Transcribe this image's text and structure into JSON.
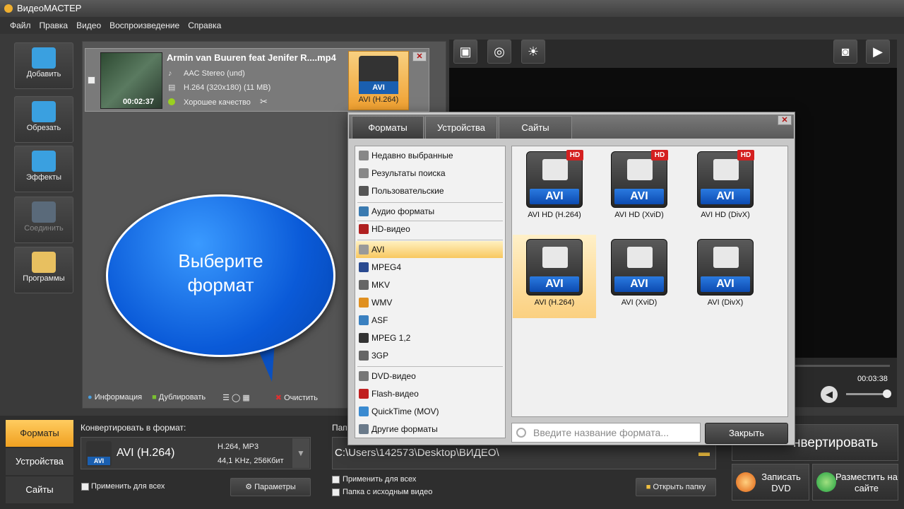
{
  "app": {
    "title": "ВидеоМАСТЕР"
  },
  "menu": [
    "Файл",
    "Правка",
    "Видео",
    "Воспроизведение",
    "Справка"
  ],
  "sidebar": [
    {
      "label": "Добавить",
      "icon": "film-add-icon",
      "color": "#3aa0e0"
    },
    {
      "label": "Обрезать",
      "icon": "scissors-icon",
      "color": "#3aa0e0"
    },
    {
      "label": "Эффекты",
      "icon": "magic-wand-icon",
      "color": "#3aa0e0"
    },
    {
      "label": "Соединить",
      "icon": "join-icon",
      "color": "#5a6a7a"
    },
    {
      "label": "Программы",
      "icon": "programs-icon",
      "color": "#e8c060"
    }
  ],
  "file": {
    "name": "Armin van Buuren feat Jenifer R....mp4",
    "duration": "00:02:37",
    "audio": "AAC Stereo (und)",
    "video": "H.264 (320x180) (11 MB)",
    "quality": "Хорошее качество",
    "format_label": "AVI (H.264)",
    "cam_label": "AVI"
  },
  "bubble": {
    "line1": "Выберите",
    "line2": "формат"
  },
  "filebar": {
    "info": "Информация",
    "duplicate": "Дублировать",
    "clear": "Очистить"
  },
  "player": {
    "time": "00:03:38"
  },
  "bottom": {
    "tabs": [
      "Форматы",
      "Устройства",
      "Сайты"
    ],
    "convert_label": "Конвертировать в формат:",
    "format_name": "AVI (H.264)",
    "format_badge": "AVI",
    "spec1": "H.264, MP3",
    "spec2": "44,1 KHz, 256Кбит",
    "apply_all": "Применить для всех",
    "params": "Параметры",
    "folder_label": "Папка",
    "path": "C:\\Users\\142573\\Desktop\\ВИДЕО\\",
    "apply_all2": "Применить для всех",
    "src_folder": "Папка с исходным видео",
    "open_folder": "Открыть папку",
    "convert": "Конвертировать",
    "convert_visible": "нвертировать",
    "dvd": "Записать DVD",
    "web": "Разместить на сайте"
  },
  "dialog": {
    "tabs": [
      "Форматы",
      "Устройства",
      "Сайты"
    ],
    "list": [
      {
        "label": "Недавно выбранные",
        "icon": "recent-icon",
        "color": "#888"
      },
      {
        "label": "Результаты поиска",
        "icon": "search-results-icon",
        "color": "#888"
      },
      {
        "label": "Пользовательские",
        "icon": "user-icon",
        "color": "#555"
      },
      {
        "label": "Аудио форматы",
        "icon": "music-note-icon",
        "color": "#3a7ab0"
      },
      {
        "label": "HD-видео",
        "icon": "hd-icon",
        "color": "#b02020"
      },
      {
        "label": "AVI",
        "icon": "disc-icon",
        "color": "#999"
      },
      {
        "label": "MPEG4",
        "icon": "mpeg4-icon",
        "color": "#2a4a90"
      },
      {
        "label": "MKV",
        "icon": "mkv-icon",
        "color": "#666"
      },
      {
        "label": "WMV",
        "icon": "wmv-icon",
        "color": "#e09020"
      },
      {
        "label": "ASF",
        "icon": "asf-icon",
        "color": "#3a80c0"
      },
      {
        "label": "MPEG 1,2",
        "icon": "mpeg-icon",
        "color": "#333"
      },
      {
        "label": "3GP",
        "icon": "phone-icon",
        "color": "#666"
      },
      {
        "label": "DVD-видео",
        "icon": "dvd-icon",
        "color": "#777"
      },
      {
        "label": "Flash-видео",
        "icon": "flash-icon",
        "color": "#c02020"
      },
      {
        "label": "QuickTime (MOV)",
        "icon": "quicktime-icon",
        "color": "#3a8ad0"
      },
      {
        "label": "Другие форматы",
        "icon": "other-formats-icon",
        "color": "#6a7a8a"
      }
    ],
    "selected_item": "AVI",
    "formats": [
      {
        "label": "AVI HD (H.264)",
        "badge": "AVI",
        "hd": "HD"
      },
      {
        "label": "AVI HD (XviD)",
        "badge": "AVI",
        "hd": "HD"
      },
      {
        "label": "AVI HD (DivX)",
        "badge": "AVI",
        "hd": "HD"
      },
      {
        "label": "AVI (H.264)",
        "badge": "AVI",
        "hd": ""
      },
      {
        "label": "AVI (XviD)",
        "badge": "AVI",
        "hd": ""
      },
      {
        "label": "AVI (DivX)",
        "badge": "AVI",
        "hd": ""
      }
    ],
    "selected_format": "AVI (H.264)",
    "search_placeholder": "Введите название формата...",
    "close": "Закрыть"
  }
}
